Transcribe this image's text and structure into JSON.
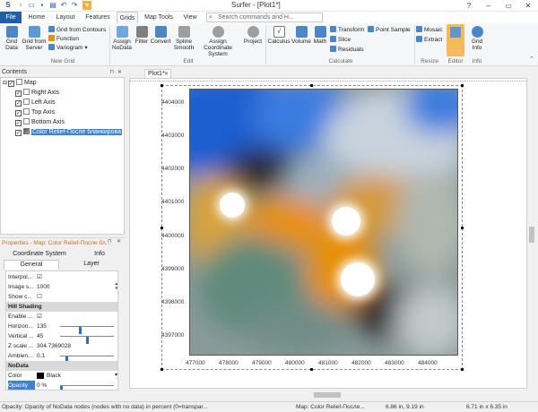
{
  "window": {
    "title": "Surfer - [Plot1*]",
    "controls": [
      "?",
      "–",
      "▭",
      "✕"
    ]
  },
  "menu": {
    "items": [
      "File",
      "Home",
      "Layout",
      "Features",
      "Grids",
      "Map Tools",
      "View"
    ],
    "active": "Grids",
    "search_placeholder": "Search commands and H..."
  },
  "ribbon": {
    "new_grid": {
      "grid_data": "Grid Data",
      "grid_from_server": "Grid from Server",
      "grid_from_contours": "Grid from Contours",
      "function": "Function",
      "variogram": "Variogram",
      "label": "New Grid"
    },
    "edit": {
      "assign_nodata": "Assign NoData",
      "filter": "Filter",
      "convert": "Convert",
      "spline_smooth": "Spline Smooth",
      "assign_coordinate_system": "Assign Coordinate System",
      "project": "Project",
      "label": "Edit"
    },
    "calculate": {
      "calculus": "Calculus",
      "volume": "Volume",
      "math": "Math",
      "transform": "Transform",
      "slice": "Slice",
      "residuals": "Residuals",
      "point_sample": "Point Sample",
      "label": "Calculate"
    },
    "resize": {
      "mosaic": "Mosaic",
      "extract": "Extract",
      "label": "Resize"
    },
    "editor": {
      "label": "Editor"
    },
    "info": {
      "grid_info": "Grid Info",
      "label": "Info"
    }
  },
  "contents": {
    "title": "Contents",
    "tree": [
      {
        "label": "Map",
        "checked": true
      },
      {
        "label": "Right Axis",
        "checked": true
      },
      {
        "label": "Left Axis",
        "checked": true
      },
      {
        "label": "Top Axis",
        "checked": true
      },
      {
        "label": "Bottom Axis",
        "checked": true
      },
      {
        "label": "Color Relief-После бланкирова",
        "checked": true,
        "selected": true
      }
    ]
  },
  "properties": {
    "title": "Properties - Map: Color Relief-После бл...",
    "tabs": [
      "Coordinate System",
      "Info",
      "General",
      "Layer"
    ],
    "rows": [
      {
        "key": "Interpol...",
        "value": "☑"
      },
      {
        "key": "Image s...",
        "value": "1000"
      },
      {
        "key": "Show c...",
        "value": "☐"
      },
      {
        "key": "Hill Shading",
        "section": true
      },
      {
        "key": "Enable ...",
        "value": "☑"
      },
      {
        "key": "Horizon...",
        "value": "135",
        "level": 0.375
      },
      {
        "key": "Vertical ...",
        "value": "45",
        "level": 0.5
      },
      {
        "key": "Z scale ...",
        "value": "304.7369028"
      },
      {
        "key": "Ambien...",
        "value": "0.1",
        "level": 0.1
      },
      {
        "key": "NoData",
        "section": true
      },
      {
        "key": "Color",
        "value": "Black"
      },
      {
        "key": "Opacity",
        "value": "0 %",
        "level": 0
      }
    ]
  },
  "document": {
    "tab_label": "Plot1*",
    "y_ticks": [
      "4404000",
      "4403000",
      "4402000",
      "4401000",
      "4400000",
      "4399000",
      "4398000",
      "4397000"
    ],
    "x_ticks": [
      "477000",
      "478000",
      "479000",
      "480000",
      "481000",
      "482000",
      "483000",
      "484000"
    ]
  },
  "status": {
    "hint": "Opacity: Opacity of NoData nodes (nodes with no data) in percent (0=transpar...",
    "selection": "Map: Color Relief-После...",
    "cursor": "6.86 in, 9.19 in",
    "size": "6.71 in x 6.35 in"
  },
  "colors": {
    "accent": "#1f5fa8",
    "selection": "#3b83d9",
    "editor_highlight": "#f5b041",
    "relief_orange": "#e8900c",
    "relief_blue": "#1a5fd0",
    "relief_teal": "#5f8a7c"
  }
}
